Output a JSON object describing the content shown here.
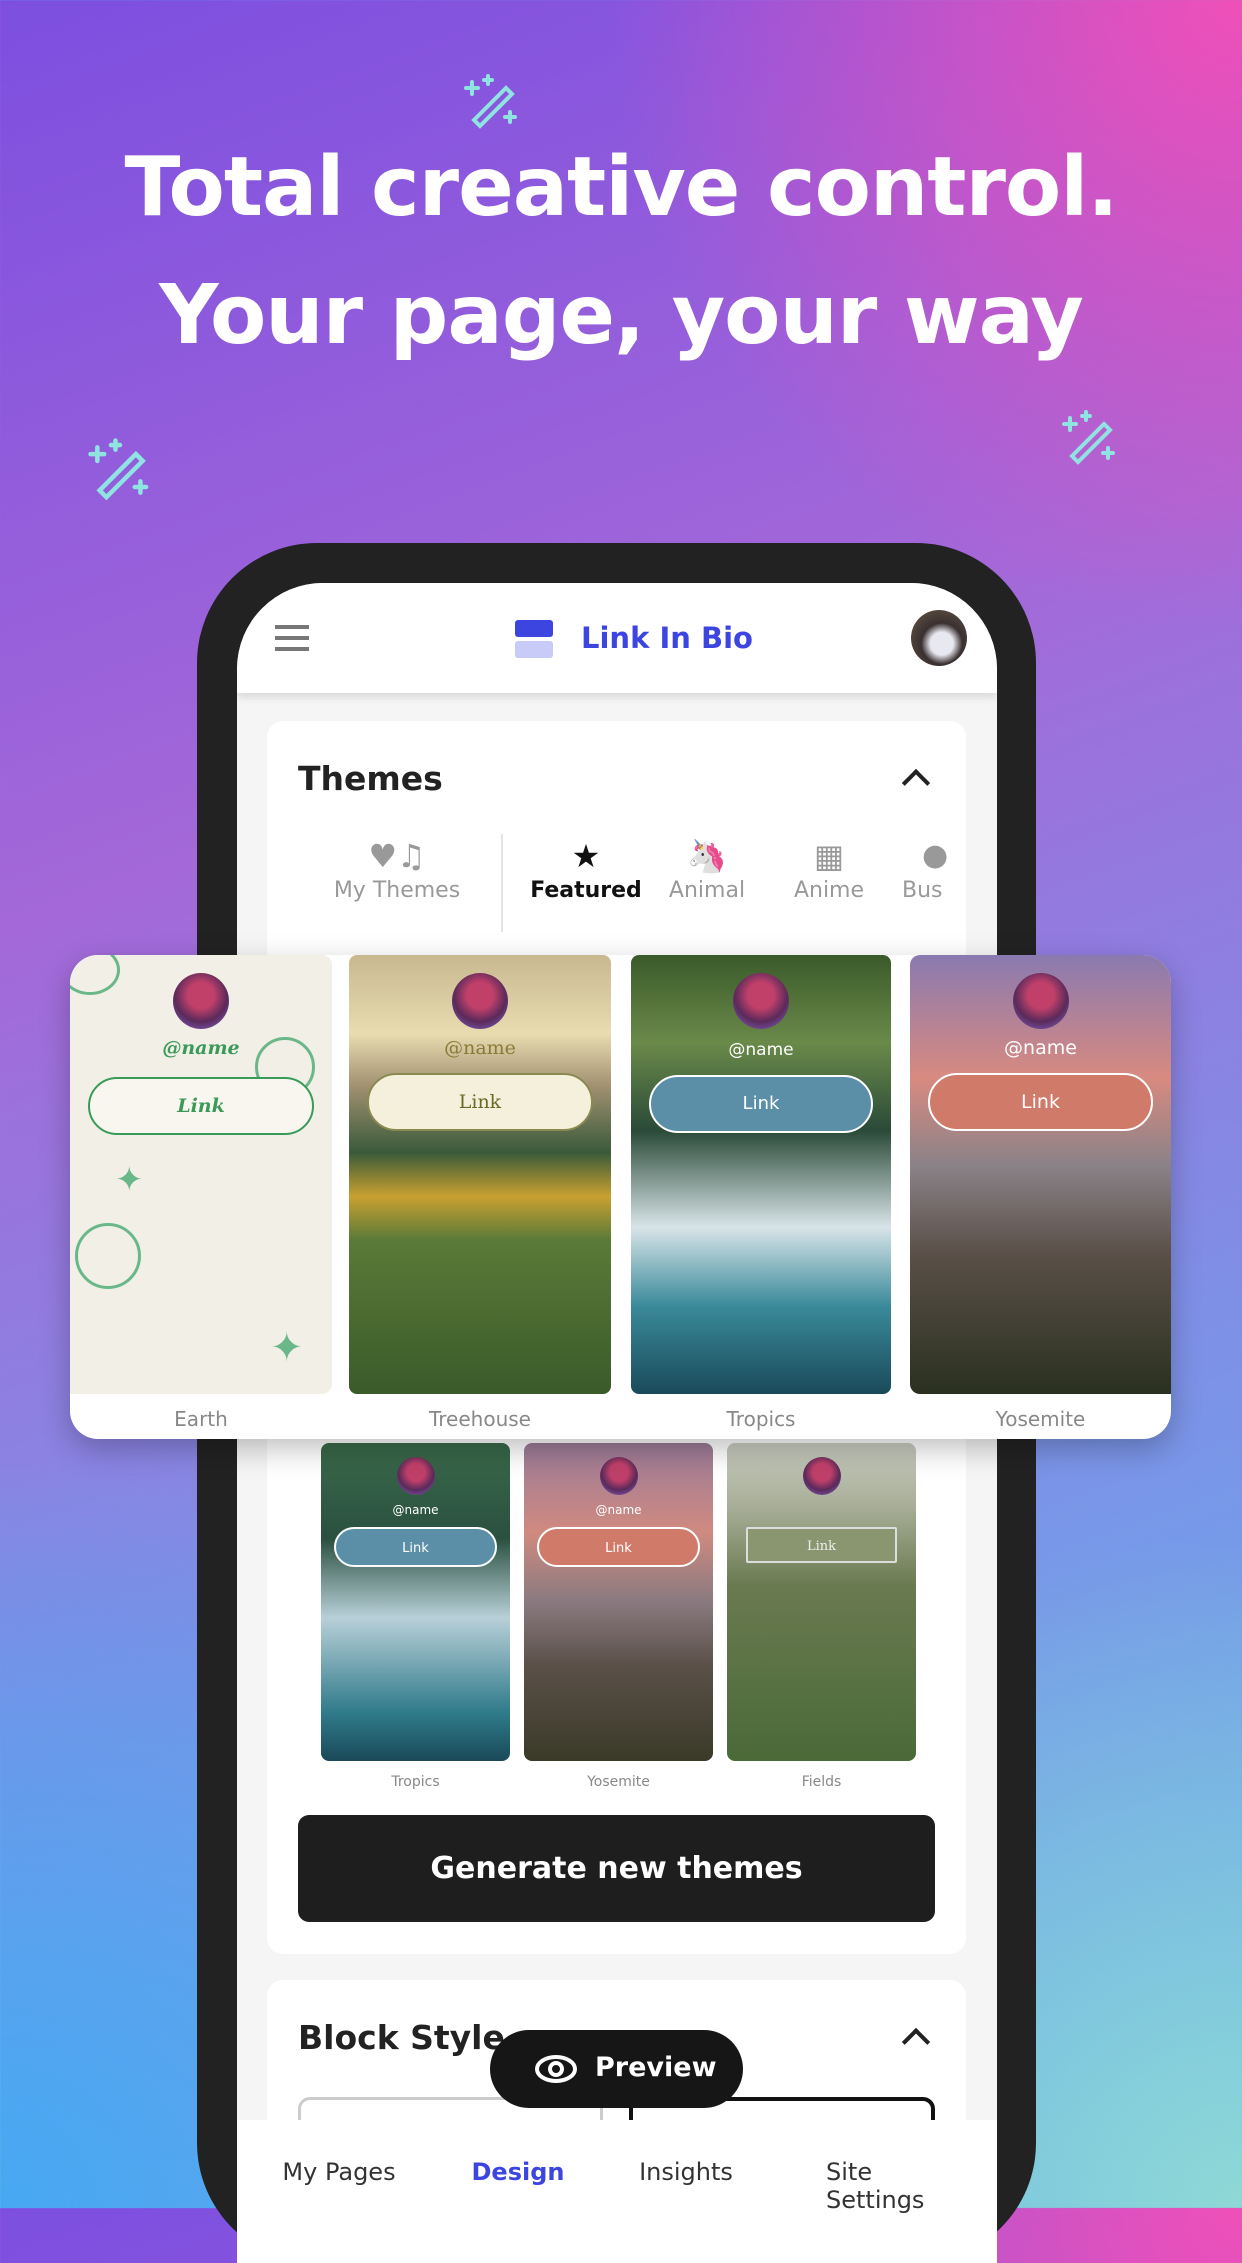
{
  "headline": {
    "line1": "Total creative control.",
    "line2": "Your page, your way"
  },
  "app": {
    "title": "Link In Bio",
    "brand_color": "#3d45e0",
    "themes": {
      "title": "Themes",
      "tabs": [
        {
          "label": "My Themes",
          "icon": "heart-music-shapes-icon",
          "active": false
        },
        {
          "label": "Featured",
          "icon": "sparkle-star-icon",
          "active": true
        },
        {
          "label": "Animal",
          "icon": "unicorn-icon",
          "active": false
        },
        {
          "label": "Anime",
          "icon": "film-icon",
          "active": false
        },
        {
          "label": "Bus",
          "icon": "business-icon",
          "active": false
        }
      ],
      "featured": [
        {
          "name": "Earth",
          "handle": "@name",
          "link": "Link"
        },
        {
          "name": "Treehouse",
          "handle": "@name",
          "link": "Link"
        },
        {
          "name": "Tropics",
          "handle": "@name",
          "link": "Link"
        },
        {
          "name": "Yosemite",
          "handle": "@name",
          "link": "Link"
        }
      ],
      "grid": [
        {
          "name": "Tropics",
          "handle": "@name",
          "link": "Link"
        },
        {
          "name": "Yosemite",
          "handle": "@name",
          "link": "Link"
        },
        {
          "name": "Fields",
          "handle": "",
          "link": "Link"
        }
      ],
      "generate_label": "Generate new themes"
    },
    "block_style": {
      "title": "Block Style"
    },
    "preview_label": "Preview",
    "bottom_nav": [
      {
        "label": "My Pages",
        "active": false
      },
      {
        "label": "Design",
        "active": true
      },
      {
        "label": "Insights",
        "active": false
      },
      {
        "label": "Site Settings",
        "active": false
      }
    ]
  }
}
